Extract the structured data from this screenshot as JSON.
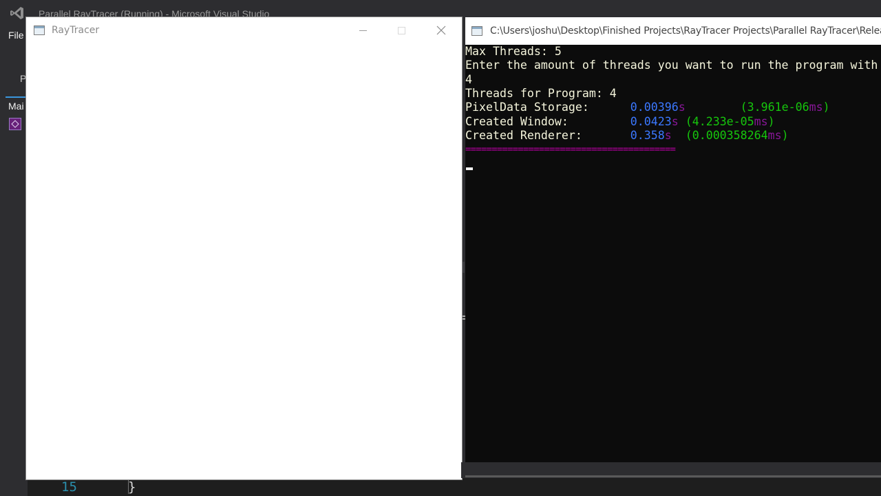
{
  "background_ide": {
    "title": "Parallel RayTracer (Running) - Microsoft Visual Studio",
    "menu_file": "File",
    "side_letter": "P",
    "tab_fragment": "Mai",
    "line_number": "15",
    "code_fragment": "}"
  },
  "raytracer_window": {
    "title": "RayTracer",
    "icon": "app-window-icon"
  },
  "console_window": {
    "title": "C:\\Users\\joshu\\Desktop\\Finished Projects\\RayTracer Projects\\Parallel RayTracer\\Release",
    "icon": "console-app-icon",
    "lines": {
      "max_threads": "Max Threads: 5",
      "prompt": "Enter the amount of threads you want to run the program with",
      "input": "4",
      "threads_for_program": "Threads for Program: 4",
      "pixeldata_label": "PixelData Storage:      ",
      "pixeldata_time": "0.00396",
      "pixeldata_unit": "s",
      "pixeldata_pad": "        ",
      "pixeldata_paren_open": "(",
      "pixeldata_ms": "3.961e-06",
      "pixeldata_ms_unit": "ms",
      "pixeldata_paren_close": ")",
      "window_label": "Created Window:         ",
      "window_time": "0.0423",
      "window_unit": "s",
      "window_pad": " ",
      "window_paren_open": "(",
      "window_ms": "4.233e-05",
      "window_ms_unit": "ms",
      "window_paren_close": ")",
      "renderer_label": "Created Renderer:       ",
      "renderer_time": "0.358",
      "renderer_unit": "s",
      "renderer_pad": "  ",
      "renderer_paren_open": "(",
      "renderer_ms": "0.000358264",
      "renderer_ms_unit": "ms",
      "renderer_paren_close": ")",
      "separator": "========================================"
    }
  },
  "colors": {
    "console_bg": "#0c0c0c",
    "console_text": "#f5f5dc",
    "seconds_value": "#3b78ff",
    "unit": "#881798",
    "ms_value": "#16c60c",
    "separator": "#b4009e"
  }
}
